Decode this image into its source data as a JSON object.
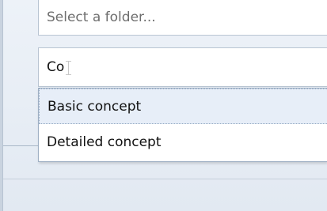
{
  "folder_picker": {
    "placeholder": "Select a folder..."
  },
  "name_input": {
    "value": "Co"
  },
  "suggestions": [
    {
      "label": "Basic concept"
    },
    {
      "label": "Detailed concept"
    }
  ],
  "colors": {
    "background": "#e6ecf4",
    "highlight": "#e7eef8",
    "border": "#9fb0c4"
  },
  "icons": [
    "text-cursor-icon"
  ]
}
